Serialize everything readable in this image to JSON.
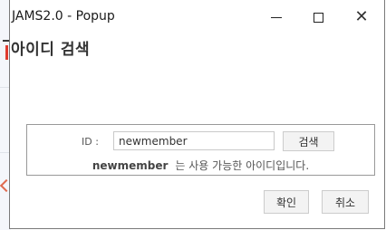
{
  "window": {
    "title": "JAMS2.0 - Popup",
    "close_glyph": "✕",
    "icons": [
      "minimize-icon",
      "maximize-icon",
      "close-icon"
    ]
  },
  "heading": "아이디 검색",
  "search": {
    "label": "ID :",
    "value": "newmember",
    "button_label": "검색"
  },
  "result": {
    "user_id": "newmember",
    "message": "는 사용 가능한 아이디입니다."
  },
  "footer": {
    "confirm_label": "확인",
    "cancel_label": "취소"
  },
  "colors": {
    "accent_red": "#e03b2f",
    "border": "#999999"
  }
}
